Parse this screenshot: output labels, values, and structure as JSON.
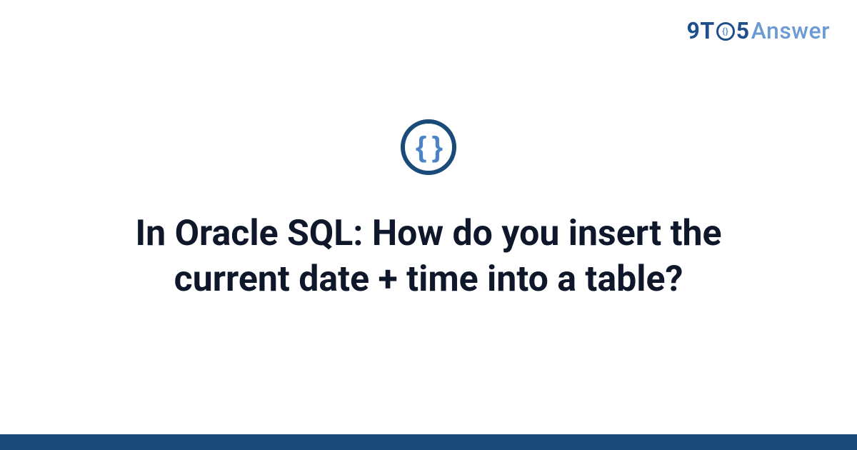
{
  "logo": {
    "brand_9": "9",
    "brand_T": "T",
    "brand_O_inner": "{}",
    "brand_5": "5",
    "brand_answer": "Answer"
  },
  "icon": {
    "braces": "{ }"
  },
  "title": "In Oracle SQL: How do you insert the current date + time into a table?",
  "colors": {
    "brand_dark": "#1a4a7a",
    "brand_light": "#6b9bd2",
    "accent_blue": "#4a84c4"
  }
}
